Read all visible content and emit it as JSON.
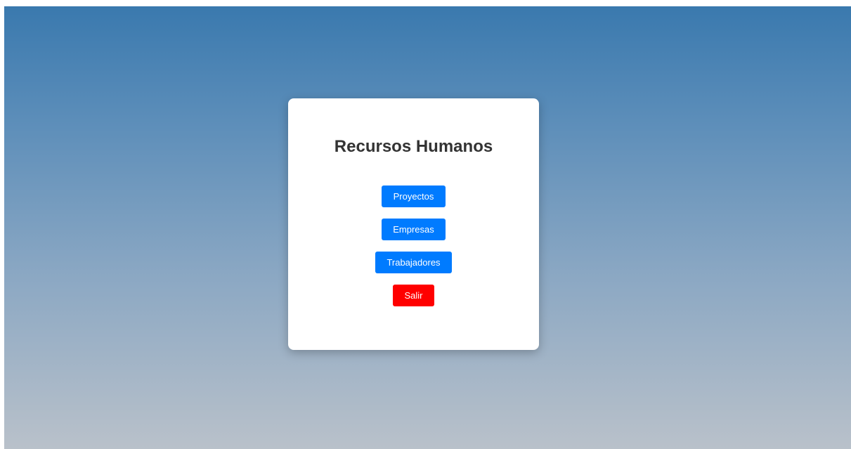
{
  "colors": {
    "gradient_top": "#3a79ae",
    "gradient_bottom": "#b9c1ca",
    "card": "#ffffff",
    "title": "#333333",
    "button_primary": "#007bff",
    "button_danger": "#ff0000"
  },
  "card": {
    "title": "Recursos Humanos",
    "buttons": [
      {
        "label": "Proyectos",
        "variant": "primary"
      },
      {
        "label": "Empresas",
        "variant": "primary"
      },
      {
        "label": "Trabajadores",
        "variant": "primary"
      },
      {
        "label": "Salir",
        "variant": "danger"
      }
    ]
  }
}
